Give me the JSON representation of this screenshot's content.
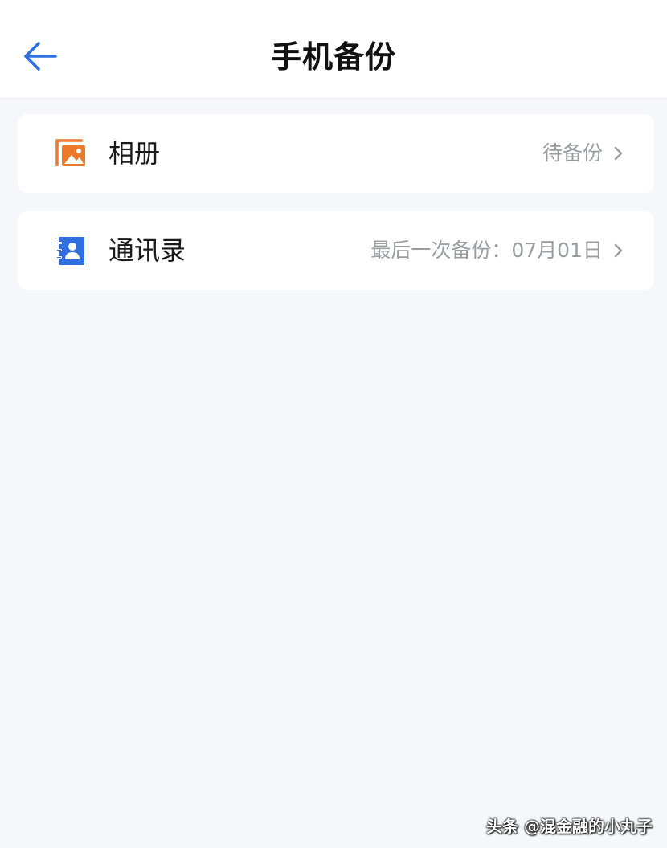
{
  "header": {
    "back_icon": "arrow-left-icon",
    "title": "手机备份"
  },
  "items": [
    {
      "icon": "photo-album-icon",
      "label": "相册",
      "status": "待备份",
      "icon_color": "#ec7a2a"
    },
    {
      "icon": "contacts-book-icon",
      "label": "通讯录",
      "status": "最后一次备份：07月01日",
      "icon_color": "#2f6fe0"
    }
  ],
  "watermark": "头条 @混金融的小丸子",
  "colors": {
    "accent": "#2f6fe0",
    "background": "#f6f7fb",
    "muted_text": "#9a9ca2"
  }
}
